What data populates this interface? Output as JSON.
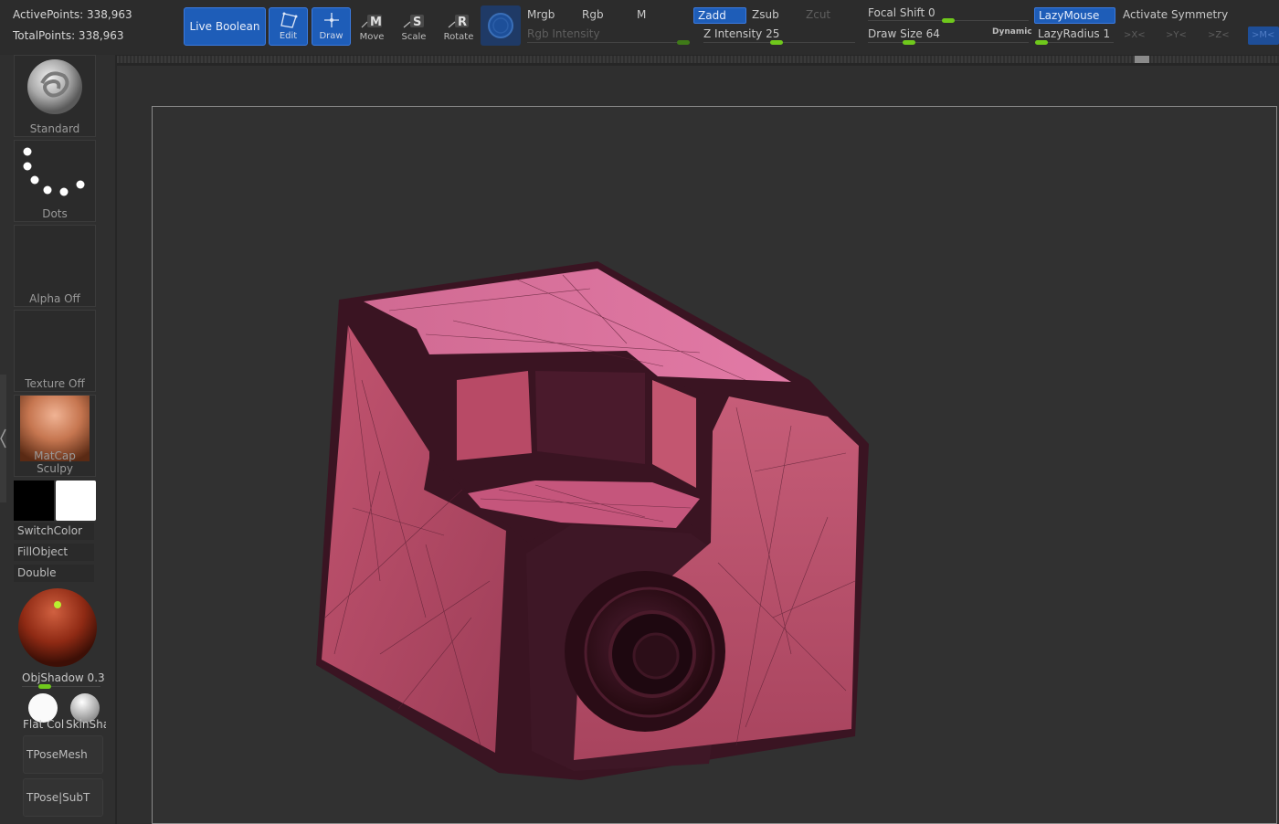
{
  "stats": {
    "active_points": "ActivePoints: 338,963",
    "total_points": "TotalPoints: 338,963"
  },
  "toolbar": {
    "live_boolean": "Live Boolean",
    "edit": "Edit",
    "draw": "Draw",
    "move": "Move",
    "scale": "Scale",
    "rotate": "Rotate",
    "mrgb": "Mrgb",
    "rgb": "Rgb",
    "m": "M",
    "rgb_intensity": "Rgb Intensity",
    "zadd": "Zadd",
    "zsub": "Zsub",
    "zcut": "Zcut",
    "z_intensity": "Z Intensity 25",
    "focal_shift": "Focal Shift 0",
    "draw_size": "Draw Size 64",
    "dynamic": "Dynamic",
    "lazy_mouse": "LazyMouse",
    "lazy_radius": "LazyRadius 1",
    "activate_symmetry": "Activate Symmetry",
    "sym_x": ">X<",
    "sym_y": ">Y<",
    "sym_z": ">Z<",
    "sym_m": ">M<"
  },
  "shelf": {
    "brush": "Standard",
    "stroke": "Dots",
    "alpha": "Alpha Off",
    "texture": "Texture Off",
    "material": "MatCap Sculpy",
    "switch_color": "SwitchColor",
    "fill_object": "FillObject",
    "double": "Double",
    "obj_shadow": "ObjShadow 0.3",
    "flat_color": "Flat Col",
    "skin_shade": "SkinSha",
    "tpose_mesh": "TPoseMesh",
    "tpose_subt": "TPose|SubT"
  },
  "colors": {
    "accent_blue": "#1e5db8",
    "slider_green": "#6fc81c",
    "mesh_pink": "#c0506c",
    "wire_dark": "#3a1422"
  },
  "icons": {
    "move": "move-m-icon",
    "scale": "scale-s-icon",
    "rotate": "rotate-r-icon",
    "edit": "edit-icon",
    "draw": "draw-icon",
    "gizmo": "gizmo-icon"
  }
}
